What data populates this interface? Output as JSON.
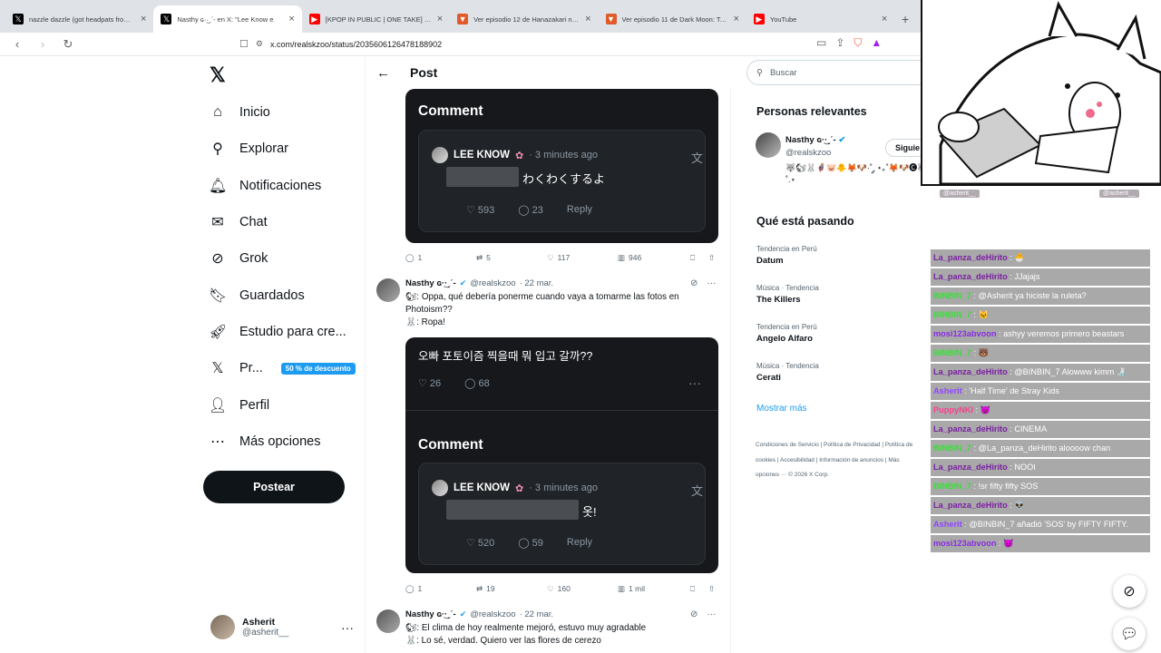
{
  "browser": {
    "tabs": [
      {
        "title": "nazzle dazzle (got headpats from ch",
        "fav": "𝕏",
        "favbg": "#000"
      },
      {
        "title": "Nasthy ɢ·͜·ˎˊ- en X: \"Lee Know e",
        "fav": "𝕏",
        "favbg": "#000"
      },
      {
        "title": "[KPOP IN PUBLIC | ONE TAKE] VIVIZ",
        "fav": "▶",
        "favbg": "#ff0000"
      },
      {
        "title": "Ver episodio 12 de Hanazakari no Ki",
        "fav": "▼",
        "favbg": "#e05a2a"
      },
      {
        "title": "Ver episodio 11 de Dark Moon: Tsuk",
        "fav": "▼",
        "favbg": "#e05a2a"
      },
      {
        "title": "YouTube",
        "fav": "▶",
        "favbg": "#ff0000"
      }
    ],
    "new_tab": "+",
    "url": "x.com/realskzoo/status/2035606126478188902"
  },
  "nav": {
    "logo": "𝕏",
    "items": [
      {
        "label": "Inicio",
        "icon": "home-icon"
      },
      {
        "label": "Explorar",
        "icon": "search-icon"
      },
      {
        "label": "Notificaciones",
        "icon": "bell-icon"
      },
      {
        "label": "Chat",
        "icon": "mail-icon"
      },
      {
        "label": "Grok",
        "icon": "grok-icon"
      },
      {
        "label": "Guardados",
        "icon": "bookmark-icon"
      },
      {
        "label": "Estudio para cre...",
        "icon": "rocket-icon"
      },
      {
        "label": "Pr...",
        "icon": "x-premium-icon"
      },
      {
        "label": "Perfil",
        "icon": "person-icon"
      },
      {
        "label": "Más opciones",
        "icon": "more-circle-icon"
      }
    ],
    "promo": "50 % de descuento",
    "post_button": "Postear",
    "account": {
      "name": "Asherit",
      "handle": "@asherit__",
      "more": "···"
    }
  },
  "post": {
    "header": "Post",
    "card1": {
      "comment_title": "Comment",
      "user": "LEE KNOW",
      "time": "· 3 minutes ago",
      "text": "わくわくするよ",
      "likes": "593",
      "replies": "23",
      "reply": "Reply"
    },
    "actions1": {
      "replies": "1",
      "reposts": "5",
      "likes": "117",
      "views": "946"
    },
    "tweet2": {
      "name": "Nasthy ɢ·͜·ˎˊ-",
      "handle": "@realskzoo",
      "date": "· 22 mar.",
      "line1": "🐿: Oppa, qué debería ponerme cuando vaya a tomarme las fotos en Photoism??",
      "line2": "🐰: Ropa!"
    },
    "card2": {
      "question": "오빠 포토이즘 찍을때 뭐 입고 갈까??",
      "likes_q": "26",
      "replies_q": "68",
      "dots": "···",
      "comment_title": "Comment",
      "user": "LEE KNOW",
      "time": "· 3 minutes ago",
      "text": "옷!",
      "likes": "520",
      "replies": "59",
      "reply": "Reply"
    },
    "actions2": {
      "replies": "1",
      "reposts": "19",
      "likes": "160",
      "views": "1 mil"
    },
    "tweet3": {
      "name": "Nasthy ɢ·͜·ˎˊ-",
      "handle": "@realskzoo",
      "date": "· 22 mar.",
      "line1": "🐿: El clima de hoy realmente mejoró, estuvo muy agradable",
      "line2": "🐰: Lo sé, verdad. Quiero ver las flores de cerezo"
    }
  },
  "right": {
    "search_placeholder": "Buscar",
    "people_title": "Personas relevantes",
    "person": {
      "name": "Nasthy ɢ·͜·ˎˊ-",
      "handle": "@realskzoo",
      "bio": "🐺🐿🐰🦸‍♂️🐷🐥🦊🐶·˚ ༘ ⋆｡˚🦊🐶🅒🐺˚.⋆",
      "follow": "Siguie"
    },
    "trends_title": "Qué está pasando",
    "trends": [
      {
        "cat": "Tendencia en Perú",
        "name": "Datum"
      },
      {
        "cat": "Música · Tendencia",
        "name": "The Killers"
      },
      {
        "cat": "Tendencia en Perú",
        "name": "Angelo Alfaro"
      },
      {
        "cat": "Música · Tendencia",
        "name": "Cerati"
      }
    ],
    "show_more": "Mostrar más",
    "footer": "Condiciones de Servicio  |  Política de Privacidad  |  Política de cookies  |  Accesibilidad  |  Información de anuncios  |  Más opciones ···  © 2026 X Corp."
  },
  "overlay": {
    "badge_left": "@asherit__",
    "badge_right": "@asherit__",
    "chat": [
      {
        "user": "La_panza_deHirito",
        "text": "🐣",
        "color": "#7a1fa2"
      },
      {
        "user": "La_panza_deHirito",
        "text": "JJajajs",
        "color": "#7a1fa2"
      },
      {
        "user": "BINBIN_7",
        "text": "@Asherit ya hiciste la ruleta?",
        "color": "#3ddc3d"
      },
      {
        "user": "BINBIN_7",
        "text": "🐱",
        "color": "#3ddc3d"
      },
      {
        "user": "mosi123abvoon",
        "text": "ashyy veremos primero beastars",
        "color": "#8a2be2"
      },
      {
        "user": "BINBIN_7",
        "text": "🐻",
        "color": "#3ddc3d"
      },
      {
        "user": "La_panza_deHirito",
        "text": "@BINBIN_7 Alowww kimm 🍶",
        "color": "#7a1fa2"
      },
      {
        "user": "Asherit",
        "text": "'Half Time' de Stray Kids",
        "color": "#9146ff"
      },
      {
        "user": "PuppyNKI",
        "text": "😈",
        "color": "#ff3c8e"
      },
      {
        "user": "La_panza_deHirito",
        "text": "CINEMA",
        "color": "#7a1fa2"
      },
      {
        "user": "BINBIN_7",
        "text": "@La_panza_deHirito aloooow chan",
        "color": "#3ddc3d"
      },
      {
        "user": "La_panza_deHirito",
        "text": "NOOI",
        "color": "#7a1fa2"
      },
      {
        "user": "BINBIN_7",
        "text": "!sr fifty fifty SOS",
        "color": "#3ddc3d"
      },
      {
        "user": "La_panza_deHirito",
        "text": "👽",
        "color": "#7a1fa2"
      },
      {
        "user": "Asherit",
        "text": "@BINBIN_7 añadió 'SOS' by FIFTY FIFTY.",
        "color": "#9146ff"
      },
      {
        "user": "mosi123abvoon",
        "text": "😈",
        "color": "#8a2be2"
      }
    ]
  }
}
